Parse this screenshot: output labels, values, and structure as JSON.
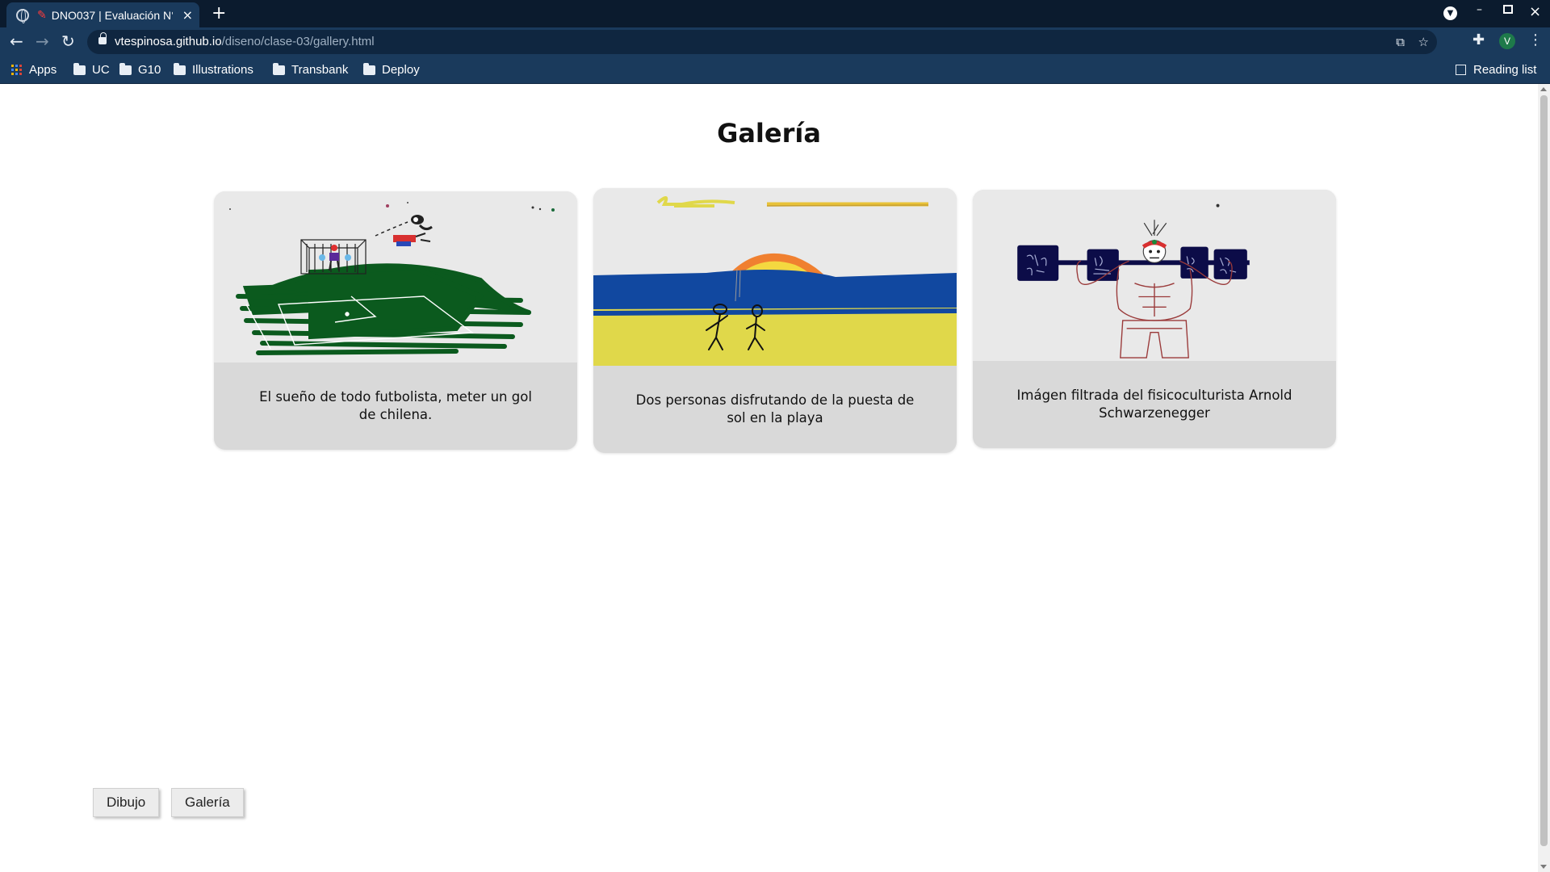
{
  "browser": {
    "tab_title": "DNO037 | Evaluación N°",
    "tab_close": "×",
    "new_tab": "+",
    "url_host": "vtespinosa.github.io",
    "url_path": "/diseno/clase-03/gallery.html",
    "avatar_letter": "V",
    "bookmarks": [
      {
        "label": "Apps",
        "icon": "apps-icon"
      },
      {
        "label": "UC",
        "icon": "folder-icon"
      },
      {
        "label": "G10",
        "icon": "folder-icon"
      },
      {
        "label": "Illustrations",
        "icon": "folder-icon"
      },
      {
        "label": "Transbank",
        "icon": "folder-icon"
      },
      {
        "label": "Deploy",
        "icon": "folder-icon"
      }
    ],
    "reading_list": "Reading list"
  },
  "page": {
    "title": "Galería",
    "cards": [
      {
        "caption": "El sueño de todo futbolista, meter un gol de chilena."
      },
      {
        "caption": "Dos personas disfrutando de la puesta de sol en la playa"
      },
      {
        "caption": "Imágen filtrada del fisicoculturista Arnold Schwarzenegger"
      }
    ],
    "drawing_labels": [
      "420 Kg",
      "420 Kilos",
      "420 Kg",
      "420 Kg"
    ],
    "nav_buttons": {
      "dibujo": "Dibujo",
      "galeria": "Galería"
    }
  },
  "colors": {
    "chrome_dark": "#0b1b2e",
    "chrome": "#1a3a5c",
    "card_caption_bg": "#d9d9d9",
    "card_image_bg": "#e9e9e9",
    "field_green": "#0b5a1e",
    "sea_blue": "#1148a0",
    "sand_yellow": "#e0d84a",
    "weight_navy": "#0c0c48"
  }
}
